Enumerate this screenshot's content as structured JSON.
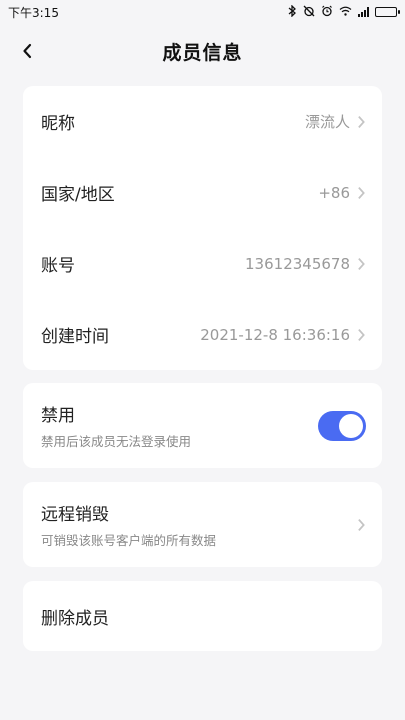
{
  "status_bar": {
    "time": "下午3:15",
    "icons": [
      "bluetooth-icon",
      "alarm-off-icon",
      "alarm-icon",
      "wifi-icon",
      "signal-icon",
      "battery-icon"
    ]
  },
  "header": {
    "title": "成员信息",
    "back_icon": "chevron-left-icon"
  },
  "info_card": {
    "rows": [
      {
        "label": "昵称",
        "value": "漂流人"
      },
      {
        "label": "国家/地区",
        "value": "+86"
      },
      {
        "label": "账号",
        "value": "13612345678"
      },
      {
        "label": "创建时间",
        "value": "2021-12-8 16:36:16"
      }
    ]
  },
  "disable_card": {
    "label": "禁用",
    "description": "禁用后该成员无法登录使用",
    "toggle_on": true
  },
  "remote_wipe_card": {
    "label": "远程销毁",
    "description": "可销毁该账号客户端的所有数据"
  },
  "delete_card": {
    "label": "删除成员"
  },
  "colors": {
    "accent": "#4a6bf2",
    "background": "#f5f5f7",
    "card": "#ffffff",
    "secondary_text": "#999999"
  }
}
